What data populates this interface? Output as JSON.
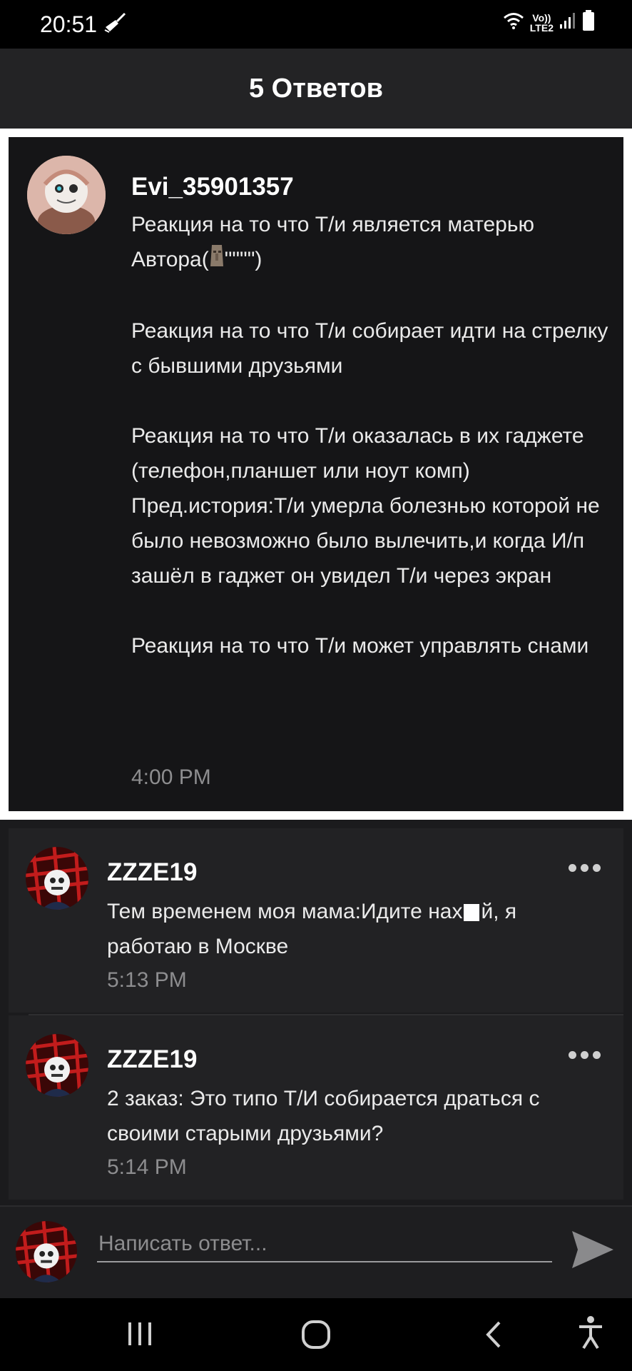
{
  "status_bar": {
    "time": "20:51",
    "network_label": "Vo))",
    "lte_label": "LTE2",
    "icons": [
      "cleaner-icon",
      "wifi-icon",
      "signal-icon",
      "battery-icon"
    ]
  },
  "header": {
    "title": "5 Ответов"
  },
  "main_post": {
    "author": "Evi_35901357",
    "text_line1": "Реакция на то что Т/и является матерью",
    "text_line2_prefix": "Автора(",
    "text_line2_suffix": "\"\"\"\")",
    "text_rest": "\n\nРеакция на то что Т/и собирает идти на стрелку с бывшими друзьями\n\nРеакция на то что Т/и оказалась в их гаджете (телефон,планшет или ноут комп)\nПред.история:Т/и умерла болезнью которой не было невозможно было вылечить,и когда И/п зашёл в гаджет он увидел Т/и через экран\n\nРеакция на то что Т/и может управлять снами",
    "time": "4:00 PM",
    "emoji": "moai-icon"
  },
  "replies": [
    {
      "author": "ZZZE19",
      "text_before": "Тем временем моя мама:Идите нах",
      "text_after": "й, я работаю в Москве",
      "time": "5:13 PM"
    },
    {
      "author": "ZZZE19",
      "text": "2 заказ: Это типо Т/И собирается драться с своими старыми друзьями?",
      "time": "5:14 PM"
    }
  ],
  "composer": {
    "placeholder": "Написать ответ..."
  },
  "nav": [
    "recents-icon",
    "home-icon",
    "back-icon",
    "accessibility-icon"
  ],
  "colors": {
    "background": "#1b1b1d",
    "header": "#232325",
    "main_post_bg": "#151517",
    "reply_bg": "#222224",
    "muted_text": "#8d8d8f"
  }
}
